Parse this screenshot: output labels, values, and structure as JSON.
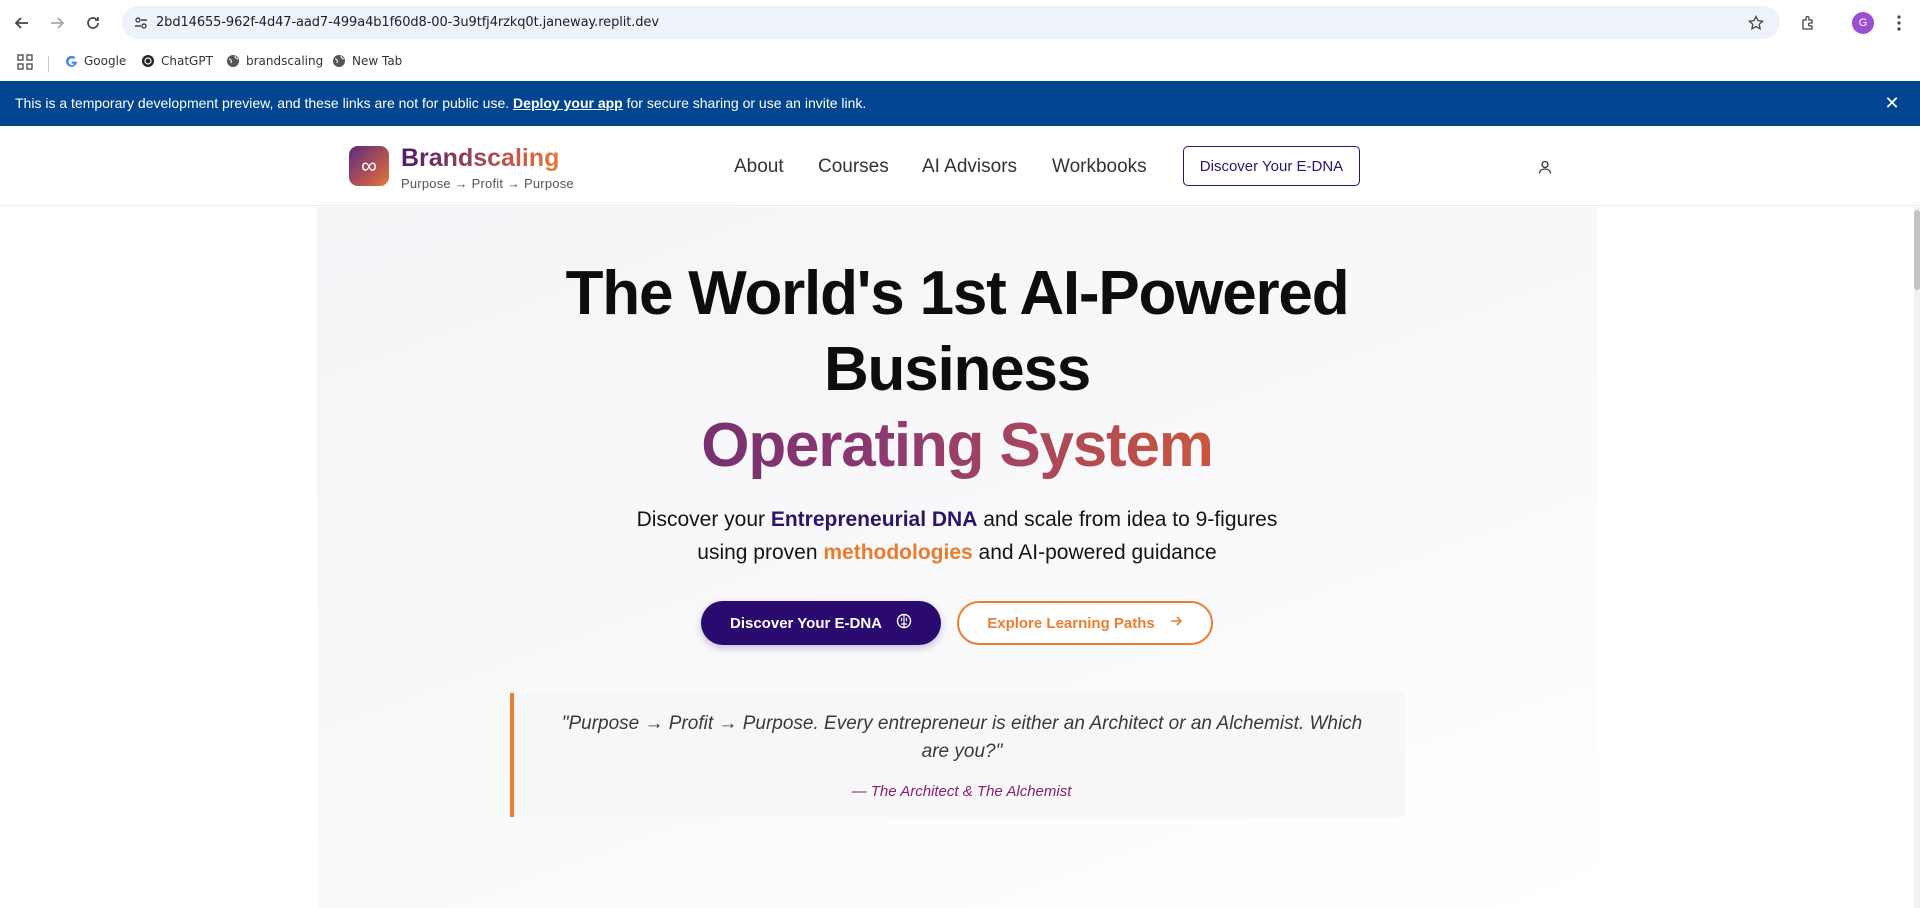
{
  "browser": {
    "url": "2bd14655-962f-4d47-aad7-499a4b1f60d8-00-3u9tfj4rzkq0t.janeway.replit.dev",
    "avatar_letter": "G",
    "bookmarks": [
      {
        "label": "Google",
        "icon": "google-icon"
      },
      {
        "label": "ChatGPT",
        "icon": "chatgpt-icon"
      },
      {
        "label": "brandscaling",
        "icon": "globe-icon"
      },
      {
        "label": "New Tab",
        "icon": "globe-icon"
      }
    ]
  },
  "banner": {
    "text_before": "This is a temporary development preview, and these links are not for public use. ",
    "link": "Deploy your app",
    "text_after": " for secure sharing or use an invite link.",
    "close_glyph": "✕"
  },
  "header": {
    "logo_glyph": "∞",
    "brand": "Brandscaling",
    "tagline": "Purpose → Profit → Purpose",
    "nav": [
      "About",
      "Courses",
      "AI Advisors",
      "Workbooks"
    ],
    "cta": "Discover Your E-DNA"
  },
  "hero": {
    "title_line1": "The World's 1st AI-Powered",
    "title_line2": "Business",
    "title_line3": "Operating System",
    "sub1_a": "Discover your ",
    "sub1_b": "Entrepreneurial DNA",
    "sub1_c": " and scale from idea to 9-figures",
    "sub2_a": "using proven ",
    "sub2_b": "methodologies",
    "sub2_c": " and AI-powered guidance",
    "primary_btn": "Discover Your E-DNA",
    "secondary_btn": "Explore Learning Paths"
  },
  "quote": {
    "text": "\"Purpose → Profit → Purpose. Every entrepreneur is either an Architect or an Alchemist. Which are you?\"",
    "author": "— The Architect & The Alchemist"
  },
  "colors": {
    "banner": "#00458f",
    "primary": "#2a0a6e",
    "accent_orange": "#ec7d2f",
    "author": "#8a1d6e"
  }
}
